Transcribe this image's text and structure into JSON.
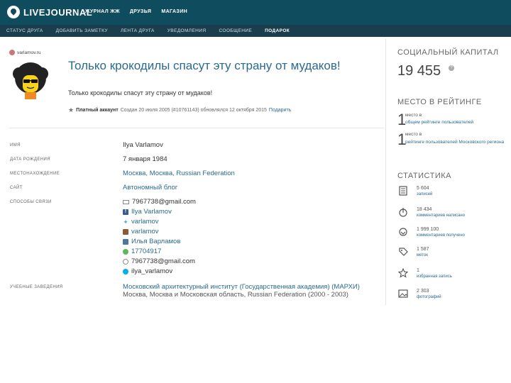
{
  "topbar": {
    "logo": "LIVEJOURNAL",
    "nav": [
      "ЖУРНАЛ ЖЖ",
      "ДРУЗЬЯ",
      "МАГАЗИН"
    ]
  },
  "subnav": {
    "items": [
      "СТАТУС ДРУГА",
      "ДОБАВИТЬ ЗАМЕТКУ",
      "ЛЕНТА ДРУГА",
      "УВЕДОМЛЕНИЯ",
      "СООБЩЕНИЕ",
      "ПОДАРОК"
    ]
  },
  "profile": {
    "username": "varlamov.ru",
    "title": "Только крокодилы спасут эту страну от мудаков!",
    "subtitle": "Только крокодилы спасут эту страну от мудаков!",
    "account_type": "Платный аккаунт",
    "created": "Создан 20 июля 2005 (#10761143) обновлялся 12 октября 2015",
    "gift_link": "Подарить"
  },
  "info": {
    "name_label": "ИМЯ",
    "name_value": "Ilya Varlamov",
    "birth_label": "ДАТА РОЖДЕНИЯ",
    "birth_value": "7 января 1984",
    "location_label": "МЕСТОНАХОЖДЕНИЕ",
    "location_value": "Москва, Москва, Russian Federation",
    "site_label": "САЙТ",
    "site_value": "Автономный блог",
    "contacts_label": "СПОСОБЫ СВЯЗИ",
    "contacts": [
      {
        "icon": "envelope-icon",
        "text": "7967738@gmail.com",
        "link": false
      },
      {
        "icon": "facebook-icon",
        "text": "Ilya Varlamov",
        "link": true
      },
      {
        "icon": "twitter-icon",
        "text": "varlamov",
        "link": true
      },
      {
        "icon": "instagram-icon",
        "text": "varlamov",
        "link": true
      },
      {
        "icon": "vk-icon",
        "text": "Илья Варламов",
        "link": true
      },
      {
        "icon": "icq-icon",
        "text": "17704917",
        "link": true
      },
      {
        "icon": "jabber-icon",
        "text": "7967738@gmail.com",
        "link": false
      },
      {
        "icon": "skype-icon",
        "text": "ilya_varlamov",
        "link": false
      }
    ],
    "edu_label": "УЧЕБНЫЕ ЗАВЕДЕНИЯ",
    "edu_name": "Московский архитектурный институт (Государственная академия) (МАРХИ)",
    "edu_place": "Москва, Москва и Московская область, Russian Federation (2000 - 2003)"
  },
  "sidebar": {
    "capital_heading": "СОЦИАЛЬНЫЙ КАПИТАЛ",
    "capital_value": "19 455",
    "capital_badge": "?",
    "rank_heading": "МЕСТО В РЕЙТИНГЕ",
    "rank1_num": "1",
    "rank1_label": "место в",
    "rank1_desc": "общем рейтинге пользователей",
    "rank2_num": "1",
    "rank2_label": "место в",
    "rank2_desc": "рейтинге пользователей Московского региона",
    "stats_heading": "СТАТИСТИКА",
    "stats": [
      {
        "icon": "journal-icon",
        "value": "5 604",
        "label": "записей"
      },
      {
        "icon": "comment-out-icon",
        "value": "18 434",
        "label": "комментариев написано"
      },
      {
        "icon": "comment-in-icon",
        "value": "1 999 100",
        "label": "комментариев получено"
      },
      {
        "icon": "tag-icon",
        "value": "1 587",
        "label": "меток"
      },
      {
        "icon": "star-icon",
        "value": "1",
        "label": "избранная запись"
      },
      {
        "icon": "photo-icon",
        "value": "2 303",
        "label": "фотографий"
      }
    ]
  }
}
